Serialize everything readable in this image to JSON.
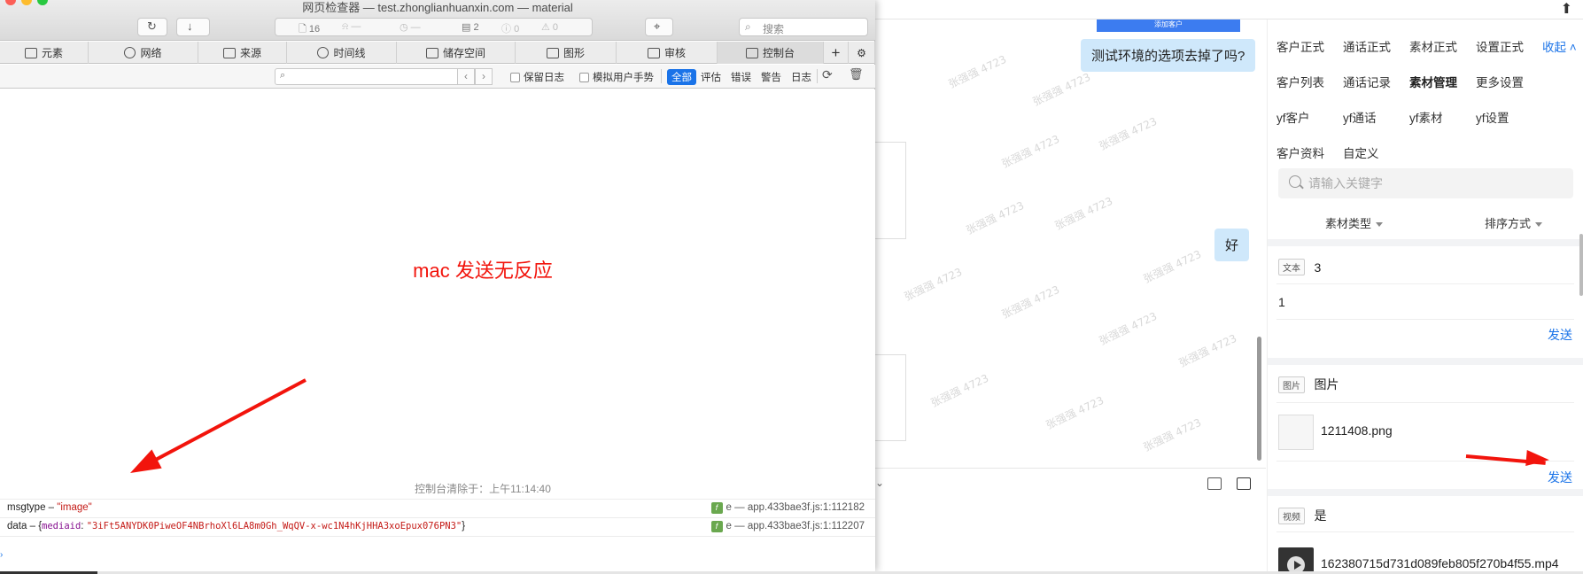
{
  "inspector": {
    "window_title": "网页检查器 — test.zhonglianhuanxin.com — material",
    "status": {
      "resources": "16",
      "requests_dim": "—",
      "time_dim": "—",
      "messages": "2",
      "errors_dim": "0",
      "warnings_dim": "0"
    },
    "search_placeholder": "搜索",
    "tabs": [
      "元素",
      "网络",
      "来源",
      "时间线",
      "储存空间",
      "图形",
      "审核",
      "控制台"
    ],
    "filter": {
      "preserve_log": "保留日志",
      "simulate_gesture": "模拟用户手势",
      "levels": [
        "全部",
        "评估",
        "错误",
        "警告",
        "日志"
      ]
    },
    "console": {
      "annotation": "mac 发送无反应",
      "cleared": "控制台清除于：上午11:14:40",
      "logs": [
        {
          "key": "msgtype",
          "sep": " – ",
          "value": "\"image\"",
          "source_fn": "e",
          "source": "— app.433bae3f.js:1:112182"
        },
        {
          "key": "data",
          "sep": " – ",
          "value_open": "{",
          "value_key": "mediaid",
          "value_colon": ": ",
          "value_str": "\"3iFt5ANYDK0PiweOF4NBrhoXl6LA8m0Gh_WqQV-x-wc1N4hKjHHA3xoEpux076PN3\"",
          "value_close": "}",
          "source_fn": "e",
          "source": "— app.433bae3f.js:1:112207"
        }
      ]
    }
  },
  "chat": {
    "top_button": "添加客户",
    "bubble1": "测试环境的选项去掉了吗?",
    "bubble2": "好",
    "watermark": "张强强 4723"
  },
  "panel": {
    "nav": [
      [
        "客户正式",
        "通话正式",
        "素材正式",
        "设置正式",
        "收起"
      ],
      [
        "客户列表",
        "通话记录",
        "素材管理",
        "更多设置"
      ],
      [
        "yf客户",
        "yf通话",
        "yf素材",
        "yf设置"
      ],
      [
        "客户资料",
        "自定义"
      ]
    ],
    "search_placeholder": "请输入关键字",
    "filter_type": "素材类型",
    "filter_sort": "排序方式",
    "cards": {
      "text": {
        "tag": "文本",
        "title": "3",
        "body": "1",
        "send": "发送"
      },
      "image": {
        "tag": "图片",
        "title": "图片",
        "file": "1211408.png",
        "send": "发送"
      },
      "video": {
        "tag": "视频",
        "title": "是",
        "file": "162380715d731d089feb805f270b4f55.mp4"
      }
    }
  },
  "colors": {
    "accent": "#1a73e8",
    "annotation_red": "#f2140c",
    "bubble": "#cfe8fb"
  }
}
